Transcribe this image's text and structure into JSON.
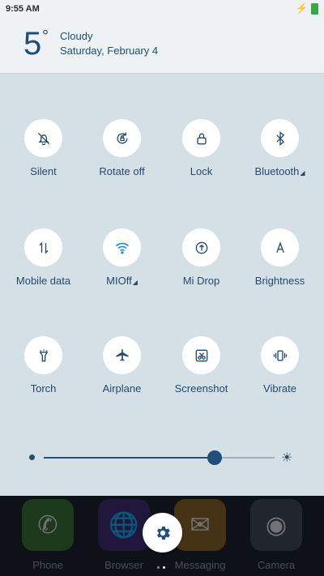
{
  "status_bar": {
    "time": "9:55 AM"
  },
  "weather": {
    "temperature": "5",
    "degree": "°",
    "condition": "Cloudy",
    "date": "Saturday, February 4"
  },
  "toggles": [
    {
      "label": "Silent",
      "icon": "bell-off-icon"
    },
    {
      "label": "Rotate off",
      "icon": "rotate-lock-icon"
    },
    {
      "label": "Lock",
      "icon": "lock-icon"
    },
    {
      "label": "Bluetooth",
      "icon": "bluetooth-icon"
    },
    {
      "label": "Mobile data",
      "icon": "mobile-data-icon"
    },
    {
      "label": "MIOff",
      "icon": "wifi-icon"
    },
    {
      "label": "Mi Drop",
      "icon": "mi-drop-icon"
    },
    {
      "label": "Brightness",
      "icon": "brightness-auto-icon"
    },
    {
      "label": "Torch",
      "icon": "torch-icon"
    },
    {
      "label": "Airplane",
      "icon": "airplane-icon"
    },
    {
      "label": "Screenshot",
      "icon": "screenshot-icon"
    },
    {
      "label": "Vibrate",
      "icon": "vibrate-icon"
    }
  ],
  "brightness": {
    "level": 0.74
  },
  "dock": [
    {
      "label": "Phone",
      "icon": "phone-icon",
      "color": "#2e6b1f"
    },
    {
      "label": "Browser",
      "icon": "globe-icon",
      "color": "#3a1f6b"
    },
    {
      "label": "Messaging",
      "icon": "envelope-icon",
      "color": "#8a5a10"
    },
    {
      "label": "Camera",
      "icon": "camera-icon",
      "color": "#3a3f47"
    }
  ],
  "colors": {
    "accent": "#1f4e79",
    "panel": "#d5dfe6",
    "dock": "#0e1218"
  }
}
